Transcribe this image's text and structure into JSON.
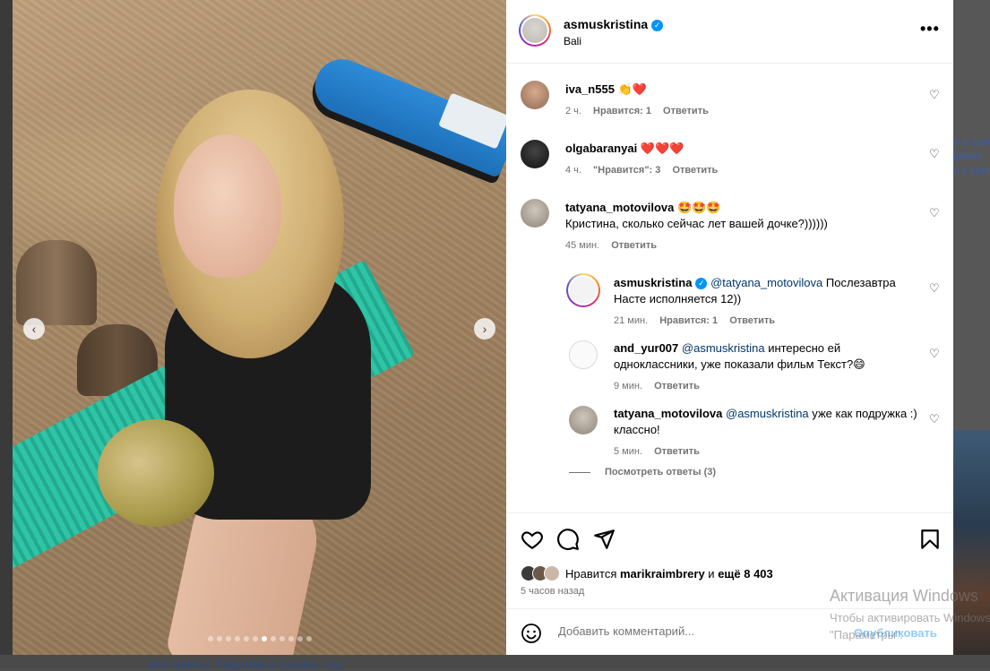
{
  "post": {
    "username": "asmuskristina",
    "location": "Bali",
    "more_label": "•••",
    "photo_dot_count": 12,
    "photo_active_index": 6,
    "prev_label": "‹",
    "next_label": "›"
  },
  "comments": [
    {
      "user": "iva_n555",
      "text": "👏❤️",
      "time": "2 ч.",
      "likes": "Нравится: 1",
      "reply": "Ответить"
    },
    {
      "user": "olgabaranyai",
      "text": "❤️❤️❤️",
      "time": "4 ч.",
      "likes": "\"Нравится\": 3",
      "reply": "Ответить"
    },
    {
      "user": "tatyana_motovilova",
      "text_emoji": "🤩🤩🤩",
      "text": "Кристина, сколько сейчас лет вашей дочке?))))))",
      "time": "45 мин.",
      "reply": "Ответить"
    }
  ],
  "replies": [
    {
      "user": "asmuskristina",
      "mention": "@tatyana_motovilova",
      "text": "Послезавтра Насте исполняется 12))",
      "time": "21 мин.",
      "likes": "Нравится: 1",
      "reply": "Ответить"
    },
    {
      "user": "and_yur007",
      "mention": "@asmuskristina",
      "text": "интересно ей одноклассники, уже показали фильм Текст?😄",
      "time": "9 мин.",
      "reply": "Ответить"
    },
    {
      "user": "tatyana_motovilova",
      "mention": "@asmuskristina",
      "text": "уже как подружка :) классно!",
      "time": "5 мин.",
      "reply": "Ответить"
    }
  ],
  "view_replies": "Посмотреть ответы (3)",
  "likes": {
    "prefix": "Нравится",
    "user": "marikraimbrery",
    "middle": "и",
    "rest": "ещё 8 403"
  },
  "time_ago": "5 часов назад",
  "add_comment": {
    "placeholder": "Добавить комментарий...",
    "post_label": "Опубликовать"
  },
  "background": {
    "bottom_text": "этот фильм. Подогнала травмы под",
    "right_text": [
      "е в сам",
      "ровня",
      "у с сем"
    ]
  },
  "watermark": {
    "title": "Активация Windows",
    "line1": "Чтобы активировать Windows,",
    "line2": "\"Параметры\"."
  }
}
